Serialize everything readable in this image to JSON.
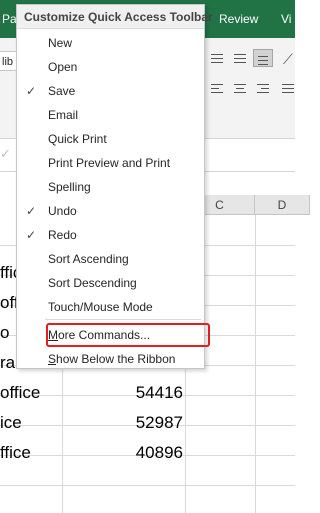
{
  "ribbon": {
    "tabs": {
      "pa": "Pa",
      "review": "Review",
      "vi": "Vi"
    },
    "font_box": "lib",
    "accent_color": "#217346"
  },
  "grid": {
    "columns": {
      "c": "C",
      "d": "D"
    },
    "rows": [
      {
        "a": "ffic",
        "b": ""
      },
      {
        "a": "off",
        "b": ""
      },
      {
        "a": "o",
        "b": ""
      },
      {
        "a": "ra",
        "b": ""
      },
      {
        "a": "office",
        "b": "54416"
      },
      {
        "a": "ice",
        "b": "52987"
      },
      {
        "a": "ffice",
        "b": "40896"
      }
    ]
  },
  "menu": {
    "title": "Customize Quick Access Toolbar",
    "items": [
      {
        "label": "New",
        "checked": false
      },
      {
        "label": "Open",
        "checked": false
      },
      {
        "label": "Save",
        "checked": true
      },
      {
        "label": "Email",
        "checked": false
      },
      {
        "label": "Quick Print",
        "checked": false
      },
      {
        "label": "Print Preview and Print",
        "checked": false
      },
      {
        "label": "Spelling",
        "checked": false
      },
      {
        "label": "Undo",
        "checked": true
      },
      {
        "label": "Redo",
        "checked": true
      },
      {
        "label": "Sort Ascending",
        "checked": false
      },
      {
        "label": "Sort Descending",
        "checked": false
      },
      {
        "label": "Touch/Mouse Mode",
        "checked": false
      }
    ],
    "more_commands": {
      "first": "M",
      "rest": "ore Commands..."
    },
    "show_below": {
      "first": "S",
      "rest": "how Below the Ribbon"
    },
    "check_glyph": "✓",
    "highlight_color": "#e02020"
  }
}
